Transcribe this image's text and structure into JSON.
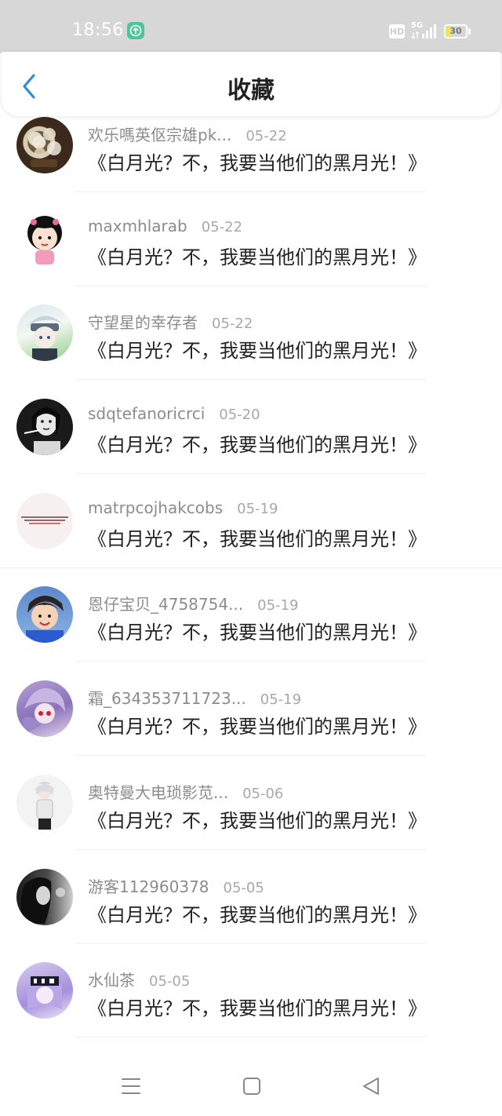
{
  "status_bar": {
    "time": "18:56",
    "hd": "HD",
    "network": "5G",
    "battery_percent": "30",
    "battery_level": 0.3
  },
  "header": {
    "title": "收藏"
  },
  "items": [
    {
      "user": "欢乐嗎英伛宗雄pk...",
      "date": "05-22",
      "title": "《白月光？不，我要当他们的黑月光！》"
    },
    {
      "user": "maxmhlarab",
      "date": "05-22",
      "title": "《白月光？不，我要当他们的黑月光！》"
    },
    {
      "user": "守望星的幸存者",
      "date": "05-22",
      "title": "《白月光？不，我要当他们的黑月光！》"
    },
    {
      "user": "sdqtefanoricrci",
      "date": "05-20",
      "title": "《白月光？不，我要当他们的黑月光！》"
    },
    {
      "user": "matrpcojhakcobs",
      "date": "05-19",
      "title": "《白月光？不，我要当他们的黑月光！》"
    },
    {
      "user": "恩仔宝贝_4758754...",
      "date": "05-19",
      "title": "《白月光？不，我要当他们的黑月光！》"
    },
    {
      "user": "霜_634353711723...",
      "date": "05-19",
      "title": "《白月光？不，我要当他们的黑月光！》"
    },
    {
      "user": "奥特曼大电琐影苋...",
      "date": "05-06",
      "title": "《白月光？不，我要当他们的黑月光！》"
    },
    {
      "user": "游客112960378",
      "date": "05-05",
      "title": "《白月光？不，我要当他们的黑月光！》"
    },
    {
      "user": "水仙茶",
      "date": "05-05",
      "title": "《白月光？不，我要当他们的黑月光！》"
    }
  ],
  "colors": {
    "accent": "#2f8ce0",
    "status_bar_bg": "#d7d7d7",
    "username": "#8c8c8c",
    "title_text": "#222222"
  },
  "icons": {
    "back": "chevron-left-icon",
    "nav_menu": "menu-icon",
    "nav_home": "home-square-icon",
    "nav_back": "triangle-back-icon"
  }
}
